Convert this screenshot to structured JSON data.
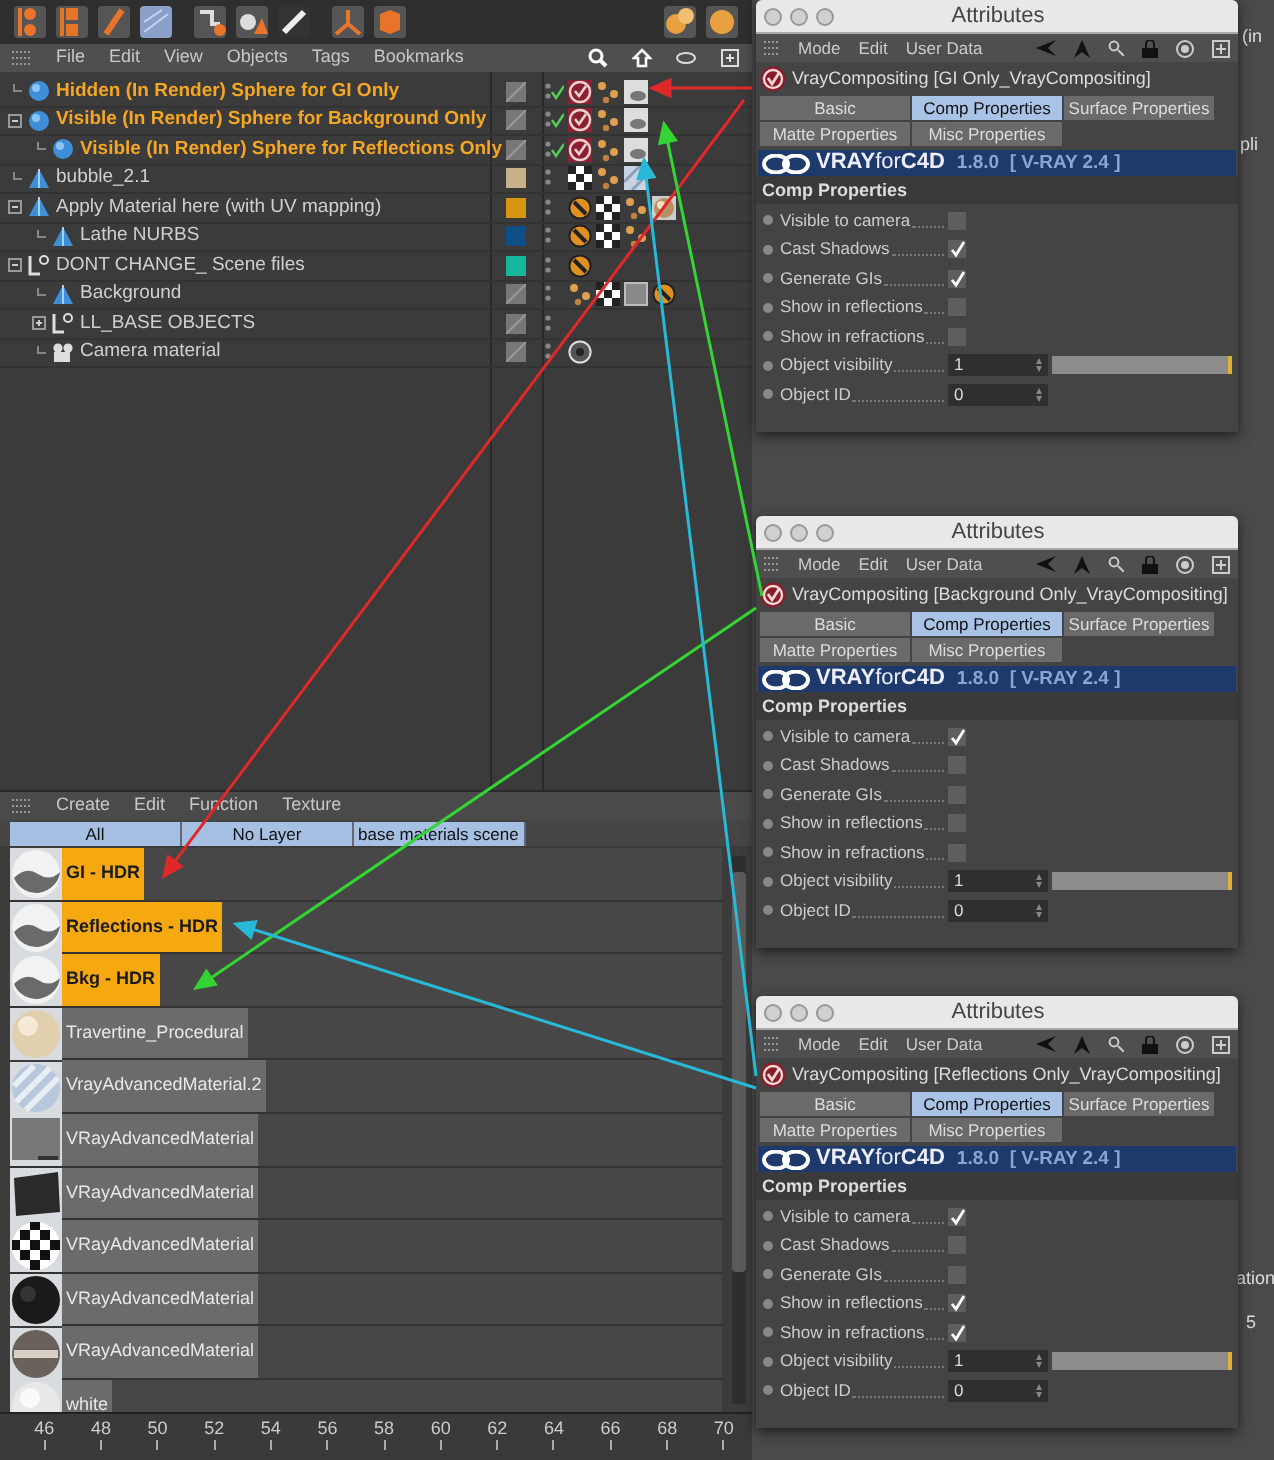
{
  "object_manager": {
    "menu": [
      "File",
      "Edit",
      "View",
      "Objects",
      "Tags",
      "Bookmarks"
    ],
    "objects": [
      {
        "name": "Hidden (In Render) Sphere for GI Only",
        "kind": "sphere",
        "selected": true,
        "render_check": true,
        "tags": [
          {
            "kind": "vray_comp"
          },
          {
            "kind": "phong"
          },
          {
            "kind": "hdr_material"
          }
        ]
      },
      {
        "name": "Visible (In Render) Sphere for Background Only",
        "kind": "sphere",
        "selected": true,
        "render_check": true,
        "tags": [
          {
            "kind": "vray_comp"
          },
          {
            "kind": "phong"
          },
          {
            "kind": "hdr_material"
          }
        ],
        "expanded": true,
        "children": [
          {
            "name": "Visible (In Render) Sphere for Reflections Only",
            "kind": "sphere",
            "selected": true,
            "render_check": true,
            "tags": [
              {
                "kind": "vray_comp"
              },
              {
                "kind": "phong"
              },
              {
                "kind": "hdr_material"
              }
            ]
          }
        ]
      },
      {
        "name": "bubble_2.1",
        "kind": "polygon",
        "selected": false,
        "render_check": false,
        "color": "#c8b08a",
        "tags": [
          {
            "kind": "checker"
          },
          {
            "kind": "phong"
          },
          {
            "kind": "striped_material"
          }
        ]
      },
      {
        "name": "Apply Material here (with UV mapping)",
        "kind": "polygon",
        "selected": false,
        "render_check": false,
        "color": "#d4960f",
        "tags": [
          {
            "kind": "forbid"
          },
          {
            "kind": "checker"
          },
          {
            "kind": "phong"
          },
          {
            "kind": "sphere_material"
          }
        ],
        "expanded": true,
        "children": [
          {
            "name": "Lathe NURBS",
            "kind": "polygon",
            "selected": false,
            "render_check": false,
            "color": "#0d4f86",
            "tags": [
              {
                "kind": "forbid"
              },
              {
                "kind": "checker"
              },
              {
                "kind": "phong"
              }
            ]
          }
        ]
      },
      {
        "name": "DONT CHANGE_ Scene files",
        "kind": "null",
        "selected": false,
        "render_check": false,
        "color": "#14b89a",
        "tags": [
          {
            "kind": "forbid"
          }
        ],
        "expanded": true,
        "children": [
          {
            "name": "Background",
            "kind": "polygon",
            "selected": false,
            "render_check": false,
            "tags": [
              {
                "kind": "phong"
              },
              {
                "kind": "checker"
              },
              {
                "kind": "gray_material"
              },
              {
                "kind": "forbid"
              }
            ]
          },
          {
            "name": "LL_BASE OBJECTS",
            "kind": "null",
            "selected": false,
            "render_check": false,
            "expanded": false
          },
          {
            "name": "Camera material",
            "kind": "camera",
            "selected": false,
            "render_check": false,
            "tags": [
              {
                "kind": "render_tag"
              }
            ]
          }
        ]
      }
    ]
  },
  "material_manager": {
    "menu": [
      "Create",
      "Edit",
      "Function",
      "Texture"
    ],
    "layers": [
      "All",
      "No Layer",
      "base materials scene"
    ],
    "materials": [
      {
        "name": "GI - HDR",
        "selected": true,
        "kind": "hdr"
      },
      {
        "name": "Reflections - HDR",
        "selected": true,
        "kind": "hdr"
      },
      {
        "name": "Bkg - HDR",
        "selected": true,
        "kind": "hdr"
      },
      {
        "name": "Travertine_Procedural",
        "selected": false,
        "kind": "travertine"
      },
      {
        "name": "VrayAdvancedMaterial.2",
        "selected": false,
        "kind": "striped"
      },
      {
        "name": "VRayAdvancedMaterial",
        "selected": false,
        "kind": "flat"
      },
      {
        "name": "VRayAdvancedMaterial",
        "selected": false,
        "kind": "dark"
      },
      {
        "name": "VRayAdvancedMaterial",
        "selected": false,
        "kind": "checker"
      },
      {
        "name": "VRayAdvancedMaterial",
        "selected": false,
        "kind": "black"
      },
      {
        "name": "VRayAdvancedMaterial",
        "selected": false,
        "kind": "chrome"
      },
      {
        "name": "white",
        "selected": false,
        "kind": "white"
      }
    ]
  },
  "timeline_ruler": [
    "46",
    "48",
    "50",
    "52",
    "54",
    "56",
    "58",
    "60",
    "62",
    "64",
    "66",
    "68",
    "70"
  ],
  "background_panel": {
    "texts": [
      "(in",
      "pli",
      "ation",
      "5"
    ]
  },
  "attribute_windows": [
    {
      "title": "Attributes",
      "menu": [
        "Mode",
        "Edit",
        "User Data"
      ],
      "object": "VrayCompositing [GI Only_VrayCompositing]",
      "tabs": [
        {
          "label": "Basic",
          "selected": false
        },
        {
          "label": "Comp Properties",
          "selected": true
        },
        {
          "label": "Surface Properties",
          "selected": false
        },
        {
          "label": "Matte Properties",
          "selected": false
        },
        {
          "label": "Misc Properties",
          "selected": false
        }
      ],
      "banner": {
        "logo": "**VRAY**for**C4D**",
        "version": "1.8.0  [ V-RAY 2.4 ]"
      },
      "section": "Comp Properties",
      "properties": [
        {
          "label": "Visible to camera",
          "kind": "checkbox",
          "checked": false
        },
        {
          "label": "Cast Shadows",
          "kind": "checkbox",
          "checked": true
        },
        {
          "label": "Generate GIs",
          "kind": "checkbox",
          "checked": true
        },
        {
          "label": "Show in reflections",
          "kind": "checkbox",
          "checked": false
        },
        {
          "label": "Show in refractions",
          "kind": "checkbox",
          "checked": false
        },
        {
          "label": "Object visibility",
          "kind": "slider",
          "value": "1",
          "level": 1
        },
        {
          "label": "Object ID",
          "kind": "number",
          "value": "0"
        }
      ]
    },
    {
      "title": "Attributes",
      "menu": [
        "Mode",
        "Edit",
        "User Data"
      ],
      "object": "VrayCompositing [Background Only_VrayCompositing]",
      "tabs": [
        {
          "label": "Basic",
          "selected": false
        },
        {
          "label": "Comp Properties",
          "selected": true
        },
        {
          "label": "Surface Properties",
          "selected": false
        },
        {
          "label": "Matte Properties",
          "selected": false
        },
        {
          "label": "Misc Properties",
          "selected": false
        }
      ],
      "banner": {
        "logo": "**VRAY**for**C4D**",
        "version": "1.8.0  [ V-RAY 2.4 ]"
      },
      "section": "Comp Properties",
      "properties": [
        {
          "label": "Visible to camera",
          "kind": "checkbox",
          "checked": true
        },
        {
          "label": "Cast Shadows",
          "kind": "checkbox",
          "checked": false
        },
        {
          "label": "Generate GIs",
          "kind": "checkbox",
          "checked": false
        },
        {
          "label": "Show in reflections",
          "kind": "checkbox",
          "checked": false
        },
        {
          "label": "Show in refractions",
          "kind": "checkbox",
          "checked": false
        },
        {
          "label": "Object visibility",
          "kind": "slider",
          "value": "1",
          "level": 1
        },
        {
          "label": "Object ID",
          "kind": "number",
          "value": "0"
        }
      ]
    },
    {
      "title": "Attributes",
      "menu": [
        "Mode",
        "Edit",
        "User Data"
      ],
      "object": "VrayCompositing [Reflections Only_VrayCompositing]",
      "tabs": [
        {
          "label": "Basic",
          "selected": false
        },
        {
          "label": "Comp Properties",
          "selected": true
        },
        {
          "label": "Surface Properties",
          "selected": false
        },
        {
          "label": "Matte Properties",
          "selected": false
        },
        {
          "label": "Misc Properties",
          "selected": false
        }
      ],
      "banner": {
        "logo": "**VRAY**for**C4D**",
        "version": "1.8.0  [ V-RAY 2.4 ]"
      },
      "section": "Comp Properties",
      "properties": [
        {
          "label": "Visible to camera",
          "kind": "checkbox",
          "checked": true
        },
        {
          "label": "Cast Shadows",
          "kind": "checkbox",
          "checked": false
        },
        {
          "label": "Generate GIs",
          "kind": "checkbox",
          "checked": false
        },
        {
          "label": "Show in reflections",
          "kind": "checkbox",
          "checked": true
        },
        {
          "label": "Show in refractions",
          "kind": "checkbox",
          "checked": true
        },
        {
          "label": "Object visibility",
          "kind": "slider",
          "value": "1",
          "level": 1
        },
        {
          "label": "Object ID",
          "kind": "number",
          "value": "0"
        }
      ]
    }
  ]
}
